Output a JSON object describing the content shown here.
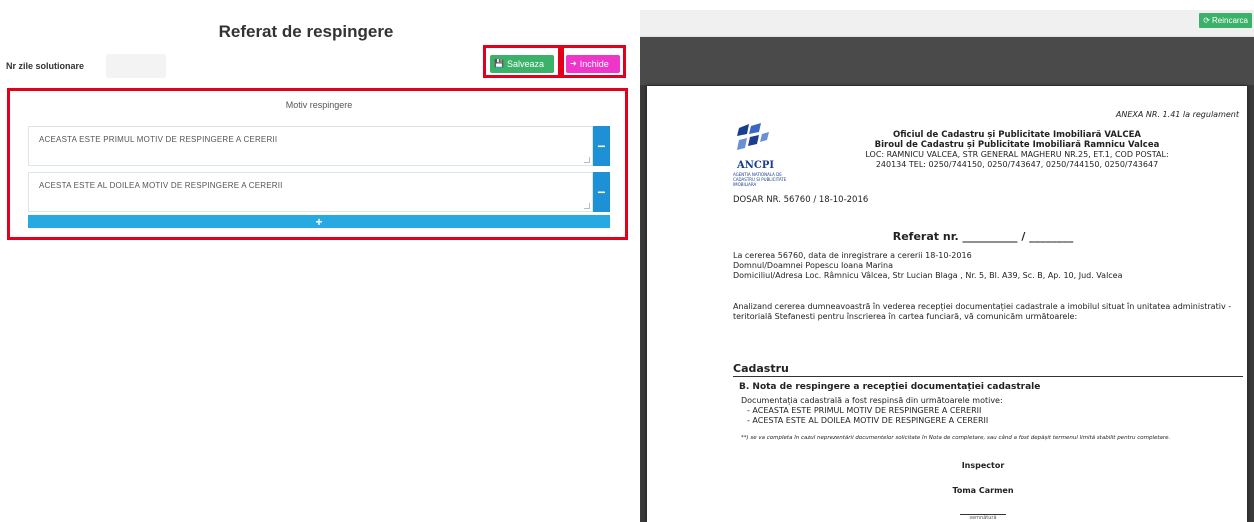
{
  "form": {
    "title": "Referat de respingere",
    "days_label": "Nr zile solutionare",
    "days_value": "",
    "save_label": "Salveaza",
    "close_label": "Inchide",
    "motiv_title": "Motiv respingere",
    "reasons": [
      {
        "text": "ACEASTA ESTE PRIMUL MOTIV DE RESPINGERE A CERERII",
        "remove_label": "−"
      },
      {
        "text": "ACESTA ESTE AL DOILEA MOTIV DE RESPINGERE A CERERII",
        "remove_label": "−"
      }
    ],
    "add_label": "+"
  },
  "viewer": {
    "reload_label": "Reincarca"
  },
  "document": {
    "annex": "ANEXA NR. 1.41 la regulament",
    "logo_text": "ANCPI",
    "logo_sub": "AGENTIA NATIONALA DE CADASTRU SI PUBLICITATE IMOBILIARA",
    "office_line1": "Oficiul de Cadastru și Publicitate Imobiliară VALCEA",
    "office_line2": "Biroul de Cadastru și Publicitate Imobiliară Ramnicu Valcea",
    "office_line3": "LOC: RAMNICU VALCEA, STR GENERAL MAGHERU NR.25, ET.1, COD POSTAL:",
    "office_line4": "240134 TEL: 0250/744150, 0250/743647, 0250/744150, 0250/743647",
    "dosar": "DOSAR NR.  56760 / 18-10-2016",
    "referat": "Referat nr. __________ / ________",
    "req_line1": "La cererea 56760, data de inregistrare a cererii  18-10-2016",
    "req_line2": "Domnul/Doamnei Popescu Ioana Marina",
    "req_line3": "Domiciliul/Adresa Loc. Râmnicu Vâlcea, Str Lucian Blaga , Nr. 5, Bl. A39, Sc. B, Ap. 10, Jud. Valcea",
    "analyze": "Analizand cererea dumneavoastră în vederea recepției documentației cadastrale a imobilul situat  în unitatea administrativ - teritorială Stefanesti pentru înscrierea în cartea funciară, vă comunicăm următoarele:",
    "section": "Cadastru",
    "nota_title": "B. Nota de respingere a recepției documentației cadastrale",
    "nota_intro": "Documentația cadastrală a fost respinsă din următoarele motive:",
    "nota_item1": "-  ACEASTA ESTE PRIMUL MOTIV DE RESPINGERE A CERERII",
    "nota_item2": "-  ACESTA ESTE AL DOILEA MOTIV DE RESPINGERE A CERERII",
    "footnote": "**) se va completa în cazul neprezentării documentelor solicitate în Nota de completare, sau când a fost depășit termenul limită stabilit pentru completare.",
    "inspector_label": "Inspector",
    "inspector_name": "Toma Carmen",
    "sign_label": "semnătură"
  },
  "colors": {
    "save": "#3cb16a",
    "close": "#ee36c8",
    "remove": "#1e90d6",
    "add": "#27a9e1",
    "highlight": "#e3001b",
    "viewer_bg": "#3a3a3a"
  }
}
